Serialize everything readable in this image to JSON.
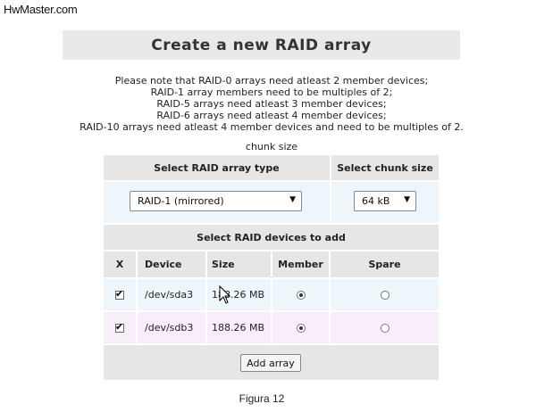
{
  "watermark": "HwMaster.com",
  "title": "Create a new RAID array",
  "notes": [
    "Please note that RAID-0 arrays need atleast 2 member devices;",
    "RAID-1 array members need to be multiples of 2;",
    "RAID-5 arrays need atleast 3 member devices;",
    "RAID-6 arrays need atleast 4 member devices;",
    "RAID-10 arrays need atleast 4 member devices and need to be multiples of 2."
  ],
  "chunk_caption": "chunk size",
  "headers": {
    "raid_type": "Select RAID array type",
    "chunk_size": "Select chunk size",
    "devices": "Select RAID devices to add"
  },
  "raid_type_select": {
    "value": "RAID-1 (mirrored)"
  },
  "chunk_select": {
    "value": "64 kB"
  },
  "columns": [
    "X",
    "Device",
    "Size",
    "Member",
    "Spare"
  ],
  "devices": [
    {
      "checked": true,
      "device": "/dev/sda3",
      "size": "188.26 MB",
      "member": true,
      "spare": false
    },
    {
      "checked": true,
      "device": "/dev/sdb3",
      "size": "188.26 MB",
      "member": true,
      "spare": false
    }
  ],
  "add_button": "Add array",
  "caption": "Figura 12",
  "icons": {
    "select_arrow": "dropdown-arrow-icon",
    "cursor": "mouse-pointer-icon"
  }
}
